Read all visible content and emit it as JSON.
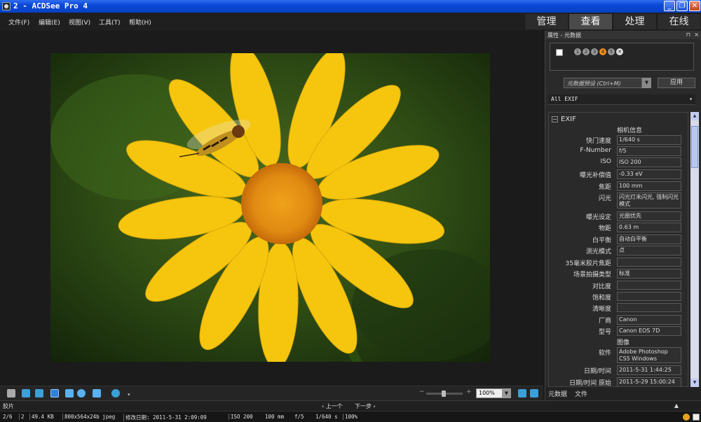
{
  "window": {
    "title": "2 - ACDSee Pro 4",
    "buttons": [
      "_",
      "❐",
      "✕"
    ]
  },
  "menu": [
    "文件(F)",
    "编辑(E)",
    "视图(V)",
    "工具(T)",
    "帮助(H)"
  ],
  "modes": [
    {
      "label": "管理",
      "active": false
    },
    {
      "label": "查看",
      "active": true
    },
    {
      "label": "处理",
      "active": false
    },
    {
      "label": "在线",
      "active": false
    }
  ],
  "panel": {
    "title": "属性 - 元数据",
    "pin": "⊓",
    "close": "×",
    "ratings": [
      "1",
      "2",
      "3",
      "4",
      "5",
      "✕"
    ],
    "preset_placeholder": "元数据预设 (Ctrl+M)",
    "apply_label": "应用",
    "exif_select": "All EXIF",
    "section_title": "EXIF",
    "section_toggle": "−",
    "group_camera": "相机信息",
    "rows": [
      {
        "label": "快门速度",
        "value": "1/640 s"
      },
      {
        "label": "F-Number",
        "value": "f/5"
      },
      {
        "label": "ISO",
        "value": "ISO 200"
      },
      {
        "label": "曝光补偿值",
        "value": "-0.33 eV"
      },
      {
        "label": "焦距",
        "value": "100 mm"
      },
      {
        "label": "闪光",
        "value": "闪光灯未闪光, 强制闪光模式"
      },
      {
        "label": "曝光设定",
        "value": "光圈优先"
      },
      {
        "label": "物距",
        "value": "0.63 m"
      },
      {
        "label": "白平衡",
        "value": "自动白平衡"
      },
      {
        "label": "测光模式",
        "value": "点"
      },
      {
        "label": "35毫米胶片焦距",
        "value": ""
      },
      {
        "label": "场景拍摄类型",
        "value": "标准"
      },
      {
        "label": "对比度",
        "value": ""
      },
      {
        "label": "饱和度",
        "value": ""
      },
      {
        "label": "清晰度",
        "value": ""
      },
      {
        "label": "厂商",
        "value": "Canon"
      },
      {
        "label": "型号",
        "value": "Canon EOS 7D"
      }
    ],
    "group_image": "图像",
    "rows2": [
      {
        "label": "软件",
        "value": "Adobe Photoshop CS5 Windows"
      },
      {
        "label": "日期/时间",
        "value": "2011-5-31 1:44:25"
      },
      {
        "label": "日期/时间 原始",
        "value": "2011-5-29 15:00:24"
      }
    ],
    "tabs": [
      "元数据",
      "文件"
    ]
  },
  "viewer": {
    "zoom": "100%"
  },
  "filmstrip": {
    "label": "胶片",
    "prev": "‹ 上一个",
    "next": "下一步 ›",
    "collapse": "▲"
  },
  "status": {
    "position": "2/6",
    "index": "2",
    "filesize": "49.4 KB",
    "dims": "800x564x24b jpeg",
    "modified": "修改日期: 2011-5-31 2:09:09",
    "iso": "ISO 200",
    "focal": "100 mm",
    "aperture": "f/5",
    "shutter": "1/640 s",
    "zoom": "100%"
  },
  "colors": {
    "accent": "#0a49d6",
    "panel_bg": "#2a2a2a",
    "petal": "#f6c60e"
  }
}
